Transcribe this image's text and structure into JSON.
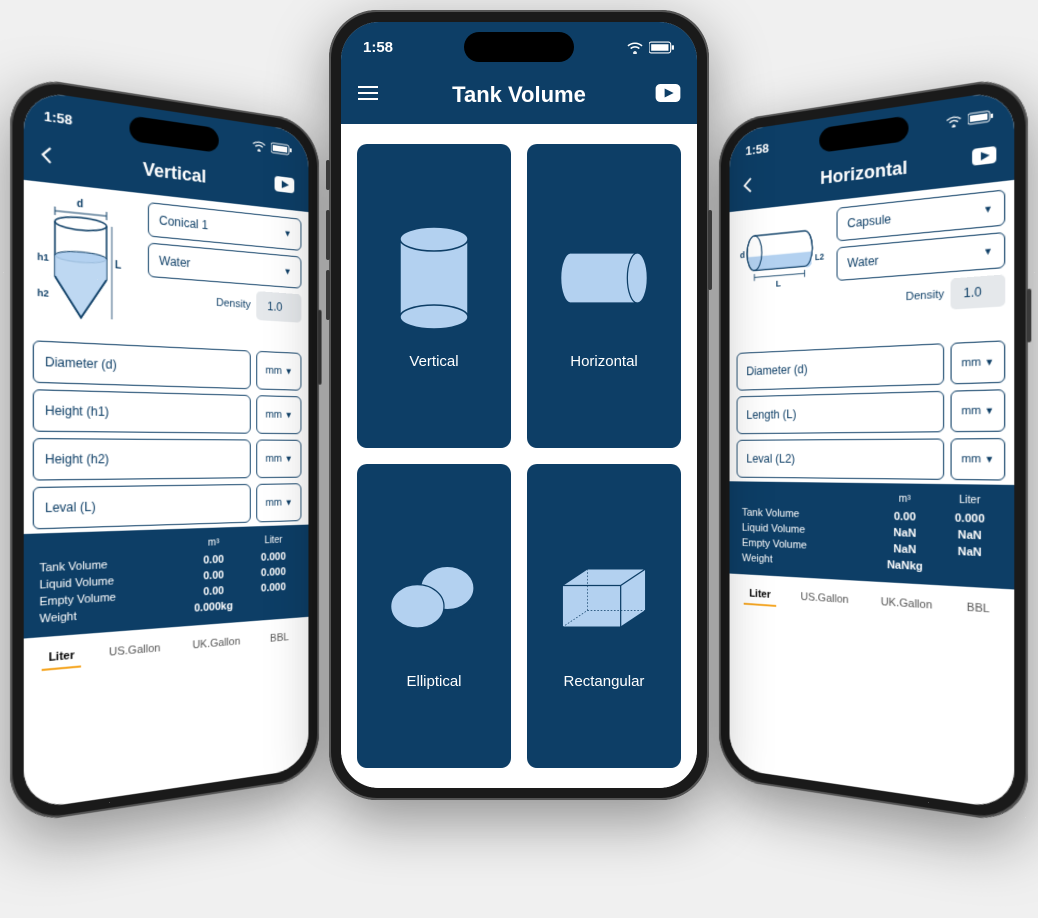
{
  "status": {
    "time": "1:58"
  },
  "center": {
    "title": "Tank Volume",
    "cards": [
      {
        "label": "Vertical"
      },
      {
        "label": "Horizontal"
      },
      {
        "label": "Elliptical"
      },
      {
        "label": "Rectangular"
      }
    ]
  },
  "left": {
    "title": "Vertical",
    "shapeSelect": "Conical 1",
    "fluidSelect": "Water",
    "densityLabel": "Density",
    "densityValue": "1.0",
    "inputs": [
      {
        "label": "Diameter (d)",
        "unit": "mm"
      },
      {
        "label": "Height (h1)",
        "unit": "mm"
      },
      {
        "label": "Height (h2)",
        "unit": "mm"
      },
      {
        "label": "Leval (L)",
        "unit": "mm"
      }
    ],
    "results": {
      "col1": "m³",
      "col2": "Liter",
      "rows": [
        {
          "label": "Tank Volume",
          "v1": "0.00",
          "v2": "0.000"
        },
        {
          "label": "Liquid Volume",
          "v1": "0.00",
          "v2": "0.000"
        },
        {
          "label": "Empty Volume",
          "v1": "0.00",
          "v2": "0.000"
        },
        {
          "label": "Weight",
          "v1": "0.000kg",
          "v2": ""
        }
      ]
    },
    "tabs": [
      "Liter",
      "US.Gallon",
      "UK.Gallon",
      "BBL"
    ],
    "activeTab": 0
  },
  "right": {
    "title": "Horizontal",
    "shapeSelect": "Capsule",
    "fluidSelect": "Water",
    "densityLabel": "Density",
    "densityValue": "1.0",
    "inputs": [
      {
        "label": "Diameter (d)",
        "unit": "mm"
      },
      {
        "label": "Length (L)",
        "unit": "mm"
      },
      {
        "label": "Leval (L2)",
        "unit": "mm"
      }
    ],
    "results": {
      "col1": "m³",
      "col2": "Liter",
      "rows": [
        {
          "label": "Tank Volume",
          "v1": "0.00",
          "v2": "0.000"
        },
        {
          "label": "Liquid Volume",
          "v1": "NaN",
          "v2": "NaN"
        },
        {
          "label": "Empty Volume",
          "v1": "NaN",
          "v2": "NaN"
        },
        {
          "label": "Weight",
          "v1": "NaNkg",
          "v2": ""
        }
      ]
    },
    "tabs": [
      "Liter",
      "US.Gallon",
      "UK.Gallon",
      "BBL"
    ],
    "activeTab": 0
  }
}
